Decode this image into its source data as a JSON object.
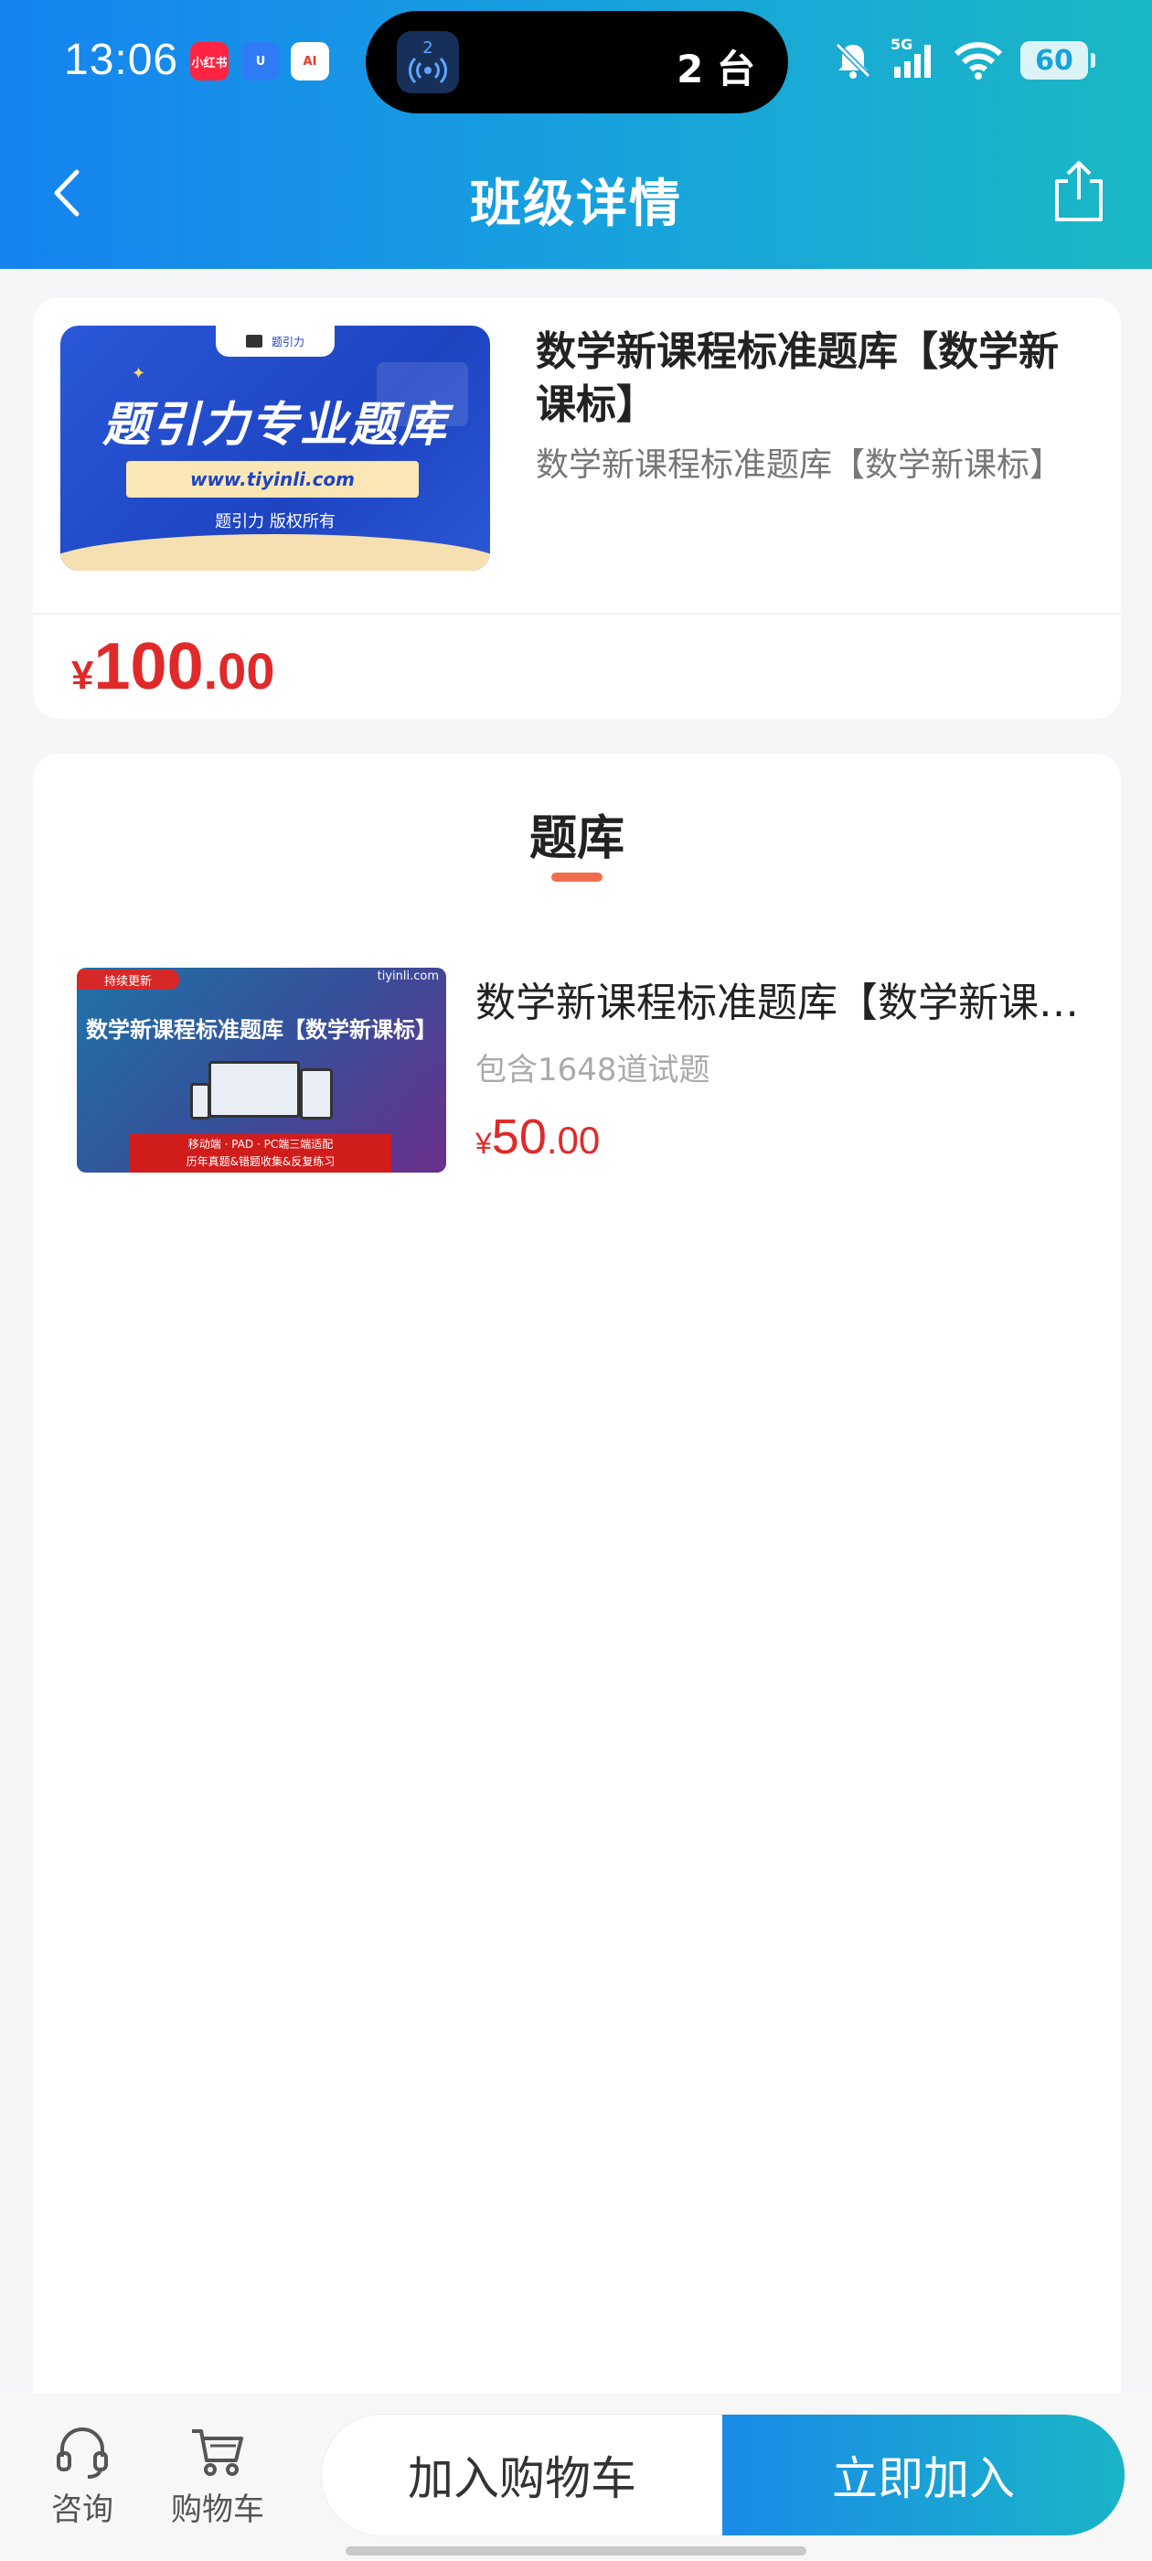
{
  "status_bar": {
    "time": "13:06",
    "app_badges": [
      "小红书",
      "U",
      "AI"
    ],
    "island_count": "2",
    "island_text": "2 台",
    "network": "5G",
    "battery": "60"
  },
  "nav": {
    "title": "班级详情"
  },
  "class_card": {
    "cover": {
      "tab_label": "题引力",
      "headline": "题引力专业题库",
      "url": "www.tiyinli.com",
      "copyright": "题引力 版权所有"
    },
    "title": "数学新课程标准题库【数学新课标】",
    "subtitle": "数学新课程标准题库【数学新课标】",
    "price": {
      "currency": "¥",
      "integer": "100",
      "decimal": ".00"
    }
  },
  "bank_section": {
    "title": "题库",
    "items": [
      {
        "cover": {
          "ribbon": "持续更新",
          "logo": "tiyinli.com",
          "title": "数学新课程标准题库【数学新课标】",
          "line1": "移动端 · PAD · PC端三端适配",
          "line2": "历年真题&错题收集&反复练习"
        },
        "title": "数学新课程标准题库【数学新课标】",
        "count": "包含1648道试题",
        "price": {
          "currency": "¥",
          "integer": "50",
          "decimal": ".00"
        }
      }
    ]
  },
  "bottom_bar": {
    "consult_label": "咨询",
    "cart_label": "购物车",
    "add_cart_button": "加入购物车",
    "join_button": "立即加入"
  }
}
